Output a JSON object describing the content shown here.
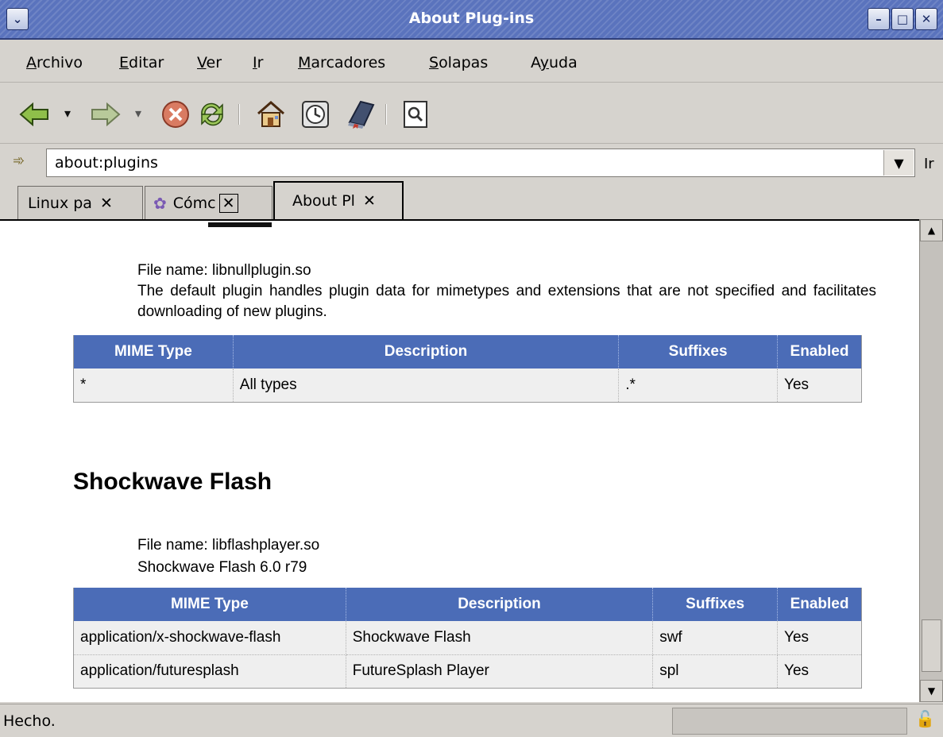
{
  "window": {
    "title": "About Plug-ins"
  },
  "menu": {
    "items": [
      {
        "pre": "",
        "key": "A",
        "post": "rchivo"
      },
      {
        "pre": "",
        "key": "E",
        "post": "ditar"
      },
      {
        "pre": "",
        "key": "V",
        "post": "er"
      },
      {
        "pre": "",
        "key": "I",
        "post": "r"
      },
      {
        "pre": "",
        "key": "M",
        "post": "arcadores"
      },
      {
        "pre": "",
        "key": "S",
        "post": "olapas"
      },
      {
        "pre": "A",
        "key": "y",
        "post": "uda"
      }
    ]
  },
  "toolbar": {
    "icons": [
      "back-icon",
      "forward-icon",
      "stop-icon",
      "reload-icon",
      "home-icon",
      "history-icon",
      "bookmarks-icon",
      "search-icon"
    ]
  },
  "location": {
    "url": "about:plugins",
    "go_label": "Ir"
  },
  "tabs": [
    {
      "label": "Linux pa",
      "close": "✕"
    },
    {
      "label": "Cómc",
      "close": "✕"
    },
    {
      "label": "About Pl",
      "close": "✕"
    }
  ],
  "plugins": {
    "default": {
      "file_name": "File name: libnullplugin.so",
      "description": "The default plugin handles plugin data for mimetypes and extensions that are not specified and facilitates downloading of new plugins.",
      "headers": [
        "MIME Type",
        "Description",
        "Suffixes",
        "Enabled"
      ],
      "rows": [
        {
          "mime": "*",
          "desc": "All types",
          "suffixes": ".*",
          "enabled": "Yes"
        }
      ]
    },
    "flash": {
      "title": "Shockwave Flash",
      "file_name": "File name: libflashplayer.so",
      "description": "Shockwave Flash 6.0 r79",
      "headers": [
        "MIME Type",
        "Description",
        "Suffixes",
        "Enabled"
      ],
      "rows": [
        {
          "mime": "application/x-shockwave-flash",
          "desc": "Shockwave Flash",
          "suffixes": "swf",
          "enabled": "Yes"
        },
        {
          "mime": "application/futuresplash",
          "desc": "FutureSplash Player",
          "suffixes": "spl",
          "enabled": "Yes"
        }
      ]
    }
  },
  "status": {
    "text": "Hecho."
  }
}
